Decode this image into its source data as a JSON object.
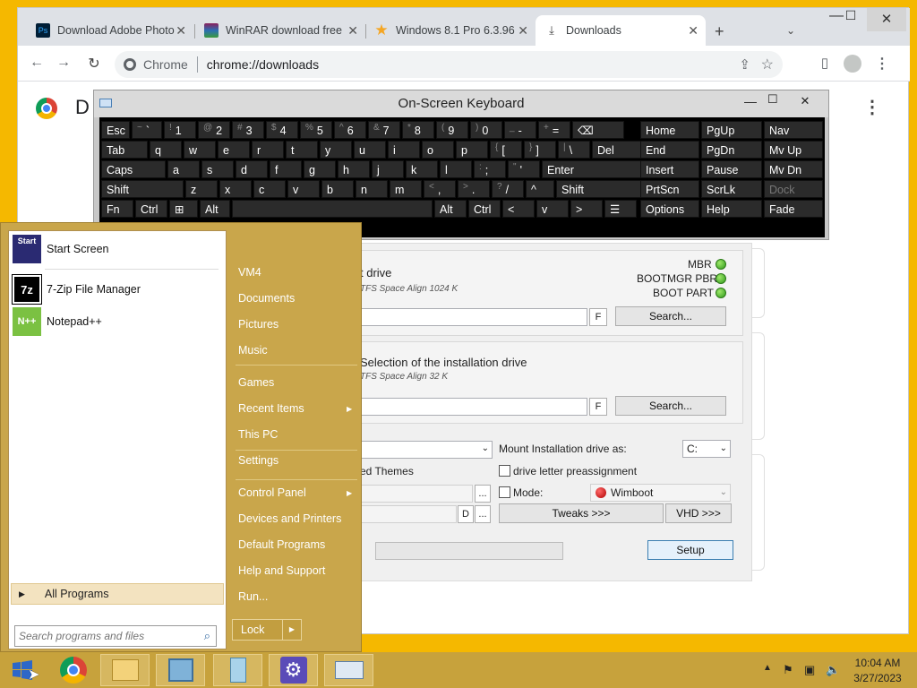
{
  "browser": {
    "tabs": [
      {
        "label": "Download Adobe Photo",
        "icon": "photoshop-icon"
      },
      {
        "label": "WinRAR download free",
        "icon": "winrar-icon"
      },
      {
        "label": "Windows 8.1 Pro 6.3.96",
        "icon": "star-icon"
      },
      {
        "label": "Downloads",
        "icon": "download-icon"
      }
    ],
    "omnibox_scheme": "Chrome",
    "omnibox_url": "chrome://downloads",
    "page_heading_initial": "D"
  },
  "setup": {
    "boot_drive_title": "t drive",
    "boot_drive_title_partial": "Selection of the boot drive",
    "boot_drive_info": "TFS Space Align 1024 K",
    "status": [
      "MBR",
      "BOOTMGR PBR",
      "BOOT PART"
    ],
    "f_label": "F",
    "search_label": "Search...",
    "install_drive_title": "Selection of the installation drive",
    "install_drive_info": "TFS Space Align 32 K",
    "mount_label": "Mount Installation drive as:",
    "mount_value": "C:",
    "preassign_label": "drive letter preassignment",
    "themes_label": "Patch to allow unsigned Themes",
    "themes_visible": "ed Themes",
    "mode_label": "Mode:",
    "mode_value": "Wimboot",
    "d_label": "D",
    "ellipsis": "...",
    "tweaks_label": "Tweaks >>>",
    "vhd_label": "VHD >>>",
    "setup_label": "Setup"
  },
  "osk": {
    "title": "On-Screen Keyboard",
    "rows": [
      [
        [
          "Esc",
          ""
        ],
        [
          "`",
          "~"
        ],
        [
          "1",
          "!"
        ],
        [
          "2",
          "@"
        ],
        [
          "3",
          "#"
        ],
        [
          "4",
          "$"
        ],
        [
          "5",
          "%"
        ],
        [
          "6",
          "^"
        ],
        [
          "7",
          "&"
        ],
        [
          "8",
          "*"
        ],
        [
          "9",
          "("
        ],
        [
          "0",
          ")"
        ],
        [
          "-",
          "_"
        ],
        [
          "=",
          "+"
        ],
        [
          "⌫",
          ""
        ]
      ],
      [
        [
          "Tab",
          ""
        ],
        [
          "q",
          ""
        ],
        [
          "w",
          ""
        ],
        [
          "e",
          ""
        ],
        [
          "r",
          ""
        ],
        [
          "t",
          ""
        ],
        [
          "y",
          ""
        ],
        [
          "u",
          ""
        ],
        [
          "i",
          ""
        ],
        [
          "o",
          ""
        ],
        [
          "p",
          ""
        ],
        [
          "[",
          "{"
        ],
        [
          "]",
          "}"
        ],
        [
          "\\",
          "|"
        ],
        [
          "Del",
          ""
        ]
      ],
      [
        [
          "Caps",
          ""
        ],
        [
          "a",
          ""
        ],
        [
          "s",
          ""
        ],
        [
          "d",
          ""
        ],
        [
          "f",
          ""
        ],
        [
          "g",
          ""
        ],
        [
          "h",
          ""
        ],
        [
          "j",
          ""
        ],
        [
          "k",
          ""
        ],
        [
          "l",
          ""
        ],
        [
          ";",
          ":"
        ],
        [
          "'",
          "\""
        ],
        [
          "Enter",
          ""
        ]
      ],
      [
        [
          "Shift",
          ""
        ],
        [
          "z",
          ""
        ],
        [
          "x",
          ""
        ],
        [
          "c",
          ""
        ],
        [
          "v",
          ""
        ],
        [
          "b",
          ""
        ],
        [
          "n",
          ""
        ],
        [
          "m",
          ""
        ],
        [
          ",",
          "<"
        ],
        [
          ".",
          ">"
        ],
        [
          "/",
          "?"
        ],
        [
          "^",
          ""
        ],
        [
          "Shift",
          ""
        ]
      ],
      [
        [
          "Fn",
          ""
        ],
        [
          "Ctrl",
          ""
        ],
        [
          "⊞",
          ""
        ],
        [
          "Alt",
          ""
        ],
        [
          "",
          ""
        ],
        [
          "Alt",
          ""
        ],
        [
          "Ctrl",
          ""
        ],
        [
          "<",
          ""
        ],
        [
          "v",
          ""
        ],
        [
          ">",
          ""
        ],
        [
          "☰",
          ""
        ]
      ]
    ],
    "nav": [
      [
        "Home",
        "PgUp",
        "Nav"
      ],
      [
        "End",
        "PgDn",
        "Mv Up"
      ],
      [
        "Insert",
        "Pause",
        "Mv Dn"
      ],
      [
        "PrtScn",
        "ScrLk",
        "Dock"
      ],
      [
        "Options",
        "Help",
        "Fade"
      ]
    ]
  },
  "start_menu": {
    "programs": [
      {
        "label": "Start Screen",
        "icon": "start-screen-icon"
      },
      {
        "label": "7-Zip File Manager",
        "icon": "7zip-icon"
      },
      {
        "label": "Notepad++",
        "icon": "notepadpp-icon"
      }
    ],
    "all_programs": "All Programs",
    "search_placeholder": "Search programs and files",
    "right_links": [
      {
        "label": "VM4",
        "arrow": false
      },
      {
        "label": "Documents",
        "arrow": false
      },
      {
        "label": "Pictures",
        "arrow": false
      },
      {
        "label": "Music",
        "arrow": false
      },
      {
        "label": "Games",
        "arrow": false
      },
      {
        "label": "Recent Items",
        "arrow": true
      },
      {
        "label": "This PC",
        "arrow": false
      },
      {
        "label": "Settings",
        "arrow": false
      },
      {
        "label": "Control Panel",
        "arrow": true
      },
      {
        "label": "Devices and Printers",
        "arrow": false
      },
      {
        "label": "Default Programs",
        "arrow": false
      },
      {
        "label": "Help and Support",
        "arrow": false
      },
      {
        "label": "Run...",
        "arrow": false
      }
    ],
    "lock_label": "Lock"
  },
  "taskbar": {
    "time": "10:04 AM",
    "date": "3/27/2023"
  },
  "colors": {
    "taskbar": "#c7a23c",
    "desktop": "#f5b800",
    "accent": "#0078d7"
  }
}
